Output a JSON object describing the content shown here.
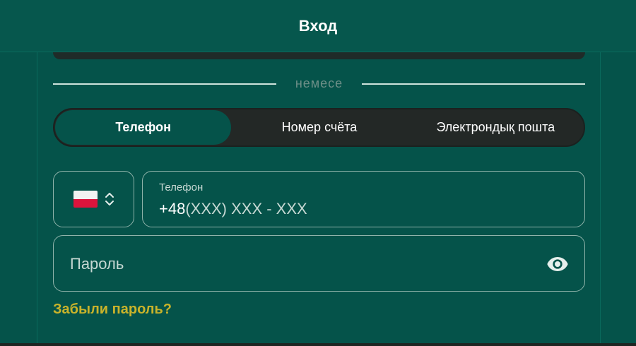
{
  "header": {
    "title": "Вход"
  },
  "divider": {
    "text": "немесе"
  },
  "tabs": [
    {
      "label": "Телефон",
      "active": true
    },
    {
      "label": "Номер счёта",
      "active": false
    },
    {
      "label": "Электрондық пошта",
      "active": false
    }
  ],
  "phone": {
    "country_icon": "poland-flag-icon",
    "label": "Телефон",
    "prefix": "+48",
    "mask": "(XXX) XXX - XXX"
  },
  "password": {
    "placeholder": "Пароль",
    "icon": "eye-icon"
  },
  "forgot": {
    "label": "Забыли пароль?"
  },
  "colors": {
    "background": "#05534a",
    "tab_bar": "#232826",
    "accent": "#c9b32a"
  }
}
